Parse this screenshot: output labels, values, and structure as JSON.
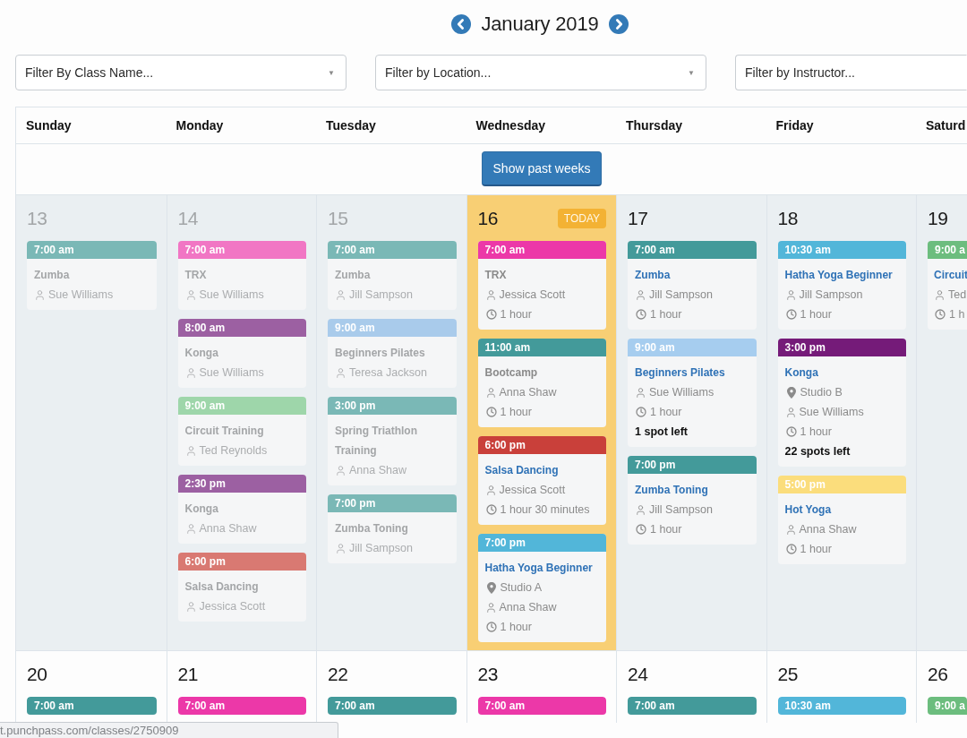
{
  "month": {
    "title": "January 2019"
  },
  "filters": [
    {
      "placeholder": "Filter By Class Name...",
      "caret": "▼"
    },
    {
      "placeholder": "Filter by Location...",
      "caret": "▼"
    },
    {
      "placeholder": "Filter by Instructor..."
    }
  ],
  "weekdays": [
    "Sunday",
    "Monday",
    "Tuesday",
    "Wednesday",
    "Thursday",
    "Friday",
    "Saturd"
  ],
  "show_past_button": "Show past weeks",
  "weeks": [
    {
      "current": true,
      "days": [
        {
          "number": "13",
          "past": true,
          "today": false,
          "classes": [
            {
              "time": "7:00 am",
              "color": "#7ab8b6",
              "title": "Zumba",
              "past": true,
              "instructor": "Sue Williams"
            }
          ]
        },
        {
          "number": "14",
          "past": true,
          "today": false,
          "classes": [
            {
              "time": "7:00 am",
              "color": "#f176c4",
              "title": "TRX",
              "past": true,
              "instructor": "Sue Williams"
            },
            {
              "time": "8:00 am",
              "color": "#9c60a2",
              "title": "Konga",
              "past": true,
              "instructor": "Sue Williams"
            },
            {
              "time": "9:00 am",
              "color": "#9ed6aa",
              "title": "Circuit Training",
              "past": true,
              "instructor": "Ted Reynolds"
            },
            {
              "time": "2:30 pm",
              "color": "#9c60a2",
              "title": "Konga",
              "past": true,
              "instructor": "Anna Shaw"
            },
            {
              "time": "6:00 pm",
              "color": "#d97972",
              "title": "Salsa Dancing",
              "past": true,
              "instructor": "Jessica Scott"
            }
          ]
        },
        {
          "number": "15",
          "past": true,
          "today": false,
          "classes": [
            {
              "time": "7:00 am",
              "color": "#7ab8b6",
              "title": "Zumba",
              "past": true,
              "instructor": "Jill Sampson"
            },
            {
              "time": "9:00 am",
              "color": "#a9cbeb",
              "title": "Beginners Pilates",
              "past": true,
              "instructor": "Teresa Jackson"
            },
            {
              "time": "3:00 pm",
              "color": "#7ab8b6",
              "title": "Spring Triathlon Training",
              "past": true,
              "instructor": "Anna Shaw"
            },
            {
              "time": "7:00 pm",
              "color": "#7ab8b6",
              "title": "Zumba Toning",
              "past": true,
              "instructor": "Jill Sampson"
            }
          ]
        },
        {
          "number": "16",
          "past": false,
          "today": true,
          "badge": "TODAY",
          "classes": [
            {
              "time": "7:00 am",
              "color": "#ec38a8",
              "title": "TRX",
              "past": true,
              "instructor": "Jessica Scott",
              "duration": "1 hour"
            },
            {
              "time": "11:00 am",
              "color": "#439a9a",
              "title": "Bootcamp",
              "past": true,
              "instructor": "Anna Shaw",
              "duration": "1 hour"
            },
            {
              "time": "6:00 pm",
              "color": "#c9403a",
              "title": "Salsa Dancing",
              "past": false,
              "instructor": "Jessica Scott",
              "duration": "1 hour 30 minutes"
            },
            {
              "time": "7:00 pm",
              "color": "#52b6d9",
              "title": "Hatha Yoga Beginner",
              "past": false,
              "location": "Studio A",
              "instructor": "Anna Shaw",
              "duration": "1 hour"
            }
          ]
        },
        {
          "number": "17",
          "past": false,
          "today": false,
          "classes": [
            {
              "time": "7:00 am",
              "color": "#439a9a",
              "title": "Zumba",
              "past": false,
              "instructor": "Jill Sampson",
              "duration": "1 hour"
            },
            {
              "time": "9:00 am",
              "color": "#a6cdef",
              "title": "Beginners Pilates",
              "past": false,
              "instructor": "Sue Williams",
              "duration": "1 hour",
              "spots": "1 spot left"
            },
            {
              "time": "7:00 pm",
              "color": "#439a9a",
              "title": "Zumba Toning",
              "past": false,
              "instructor": "Jill Sampson",
              "duration": "1 hour"
            }
          ]
        },
        {
          "number": "18",
          "past": false,
          "today": false,
          "classes": [
            {
              "time": "10:30 am",
              "color": "#52b6d9",
              "title": "Hatha Yoga Beginner",
              "past": false,
              "instructor": "Jill Sampson",
              "duration": "1 hour"
            },
            {
              "time": "3:00 pm",
              "color": "#751b79",
              "title": "Konga",
              "past": false,
              "location": "Studio B",
              "instructor": "Sue Williams",
              "duration": "1 hour",
              "spots": "22 spots left"
            },
            {
              "time": "5:00 pm",
              "color": "#fbdd7c",
              "title": "Hot Yoga",
              "past": false,
              "instructor": "Anna Shaw",
              "duration": "1 hour"
            }
          ]
        },
        {
          "number": "19",
          "past": false,
          "today": false,
          "classes": [
            {
              "time": "9:00 a",
              "color": "#6cbd7e",
              "title": "Circuit",
              "past": false,
              "instructor": "Ted",
              "duration": "1 h"
            }
          ]
        }
      ]
    },
    {
      "current": false,
      "days": [
        {
          "number": "20",
          "past": false,
          "today": false,
          "classes": [
            {
              "time": "7:00 am",
              "color": "#439a9a"
            }
          ]
        },
        {
          "number": "21",
          "past": false,
          "today": false,
          "classes": [
            {
              "time": "7:00 am",
              "color": "#ec38a8"
            }
          ]
        },
        {
          "number": "22",
          "past": false,
          "today": false,
          "classes": [
            {
              "time": "7:00 am",
              "color": "#439a9a"
            }
          ]
        },
        {
          "number": "23",
          "past": false,
          "today": false,
          "classes": [
            {
              "time": "7:00 am",
              "color": "#ec38a8"
            }
          ]
        },
        {
          "number": "24",
          "past": false,
          "today": false,
          "classes": [
            {
              "time": "7:00 am",
              "color": "#439a9a"
            }
          ]
        },
        {
          "number": "25",
          "past": false,
          "today": false,
          "classes": [
            {
              "time": "10:30 am",
              "color": "#52b6d9"
            }
          ]
        },
        {
          "number": "26",
          "past": false,
          "today": false,
          "classes": [
            {
              "time": "9:00 a",
              "color": "#6cbd7e"
            }
          ]
        }
      ]
    }
  ],
  "status_url": "t.punchpass.com/classes/2750909"
}
